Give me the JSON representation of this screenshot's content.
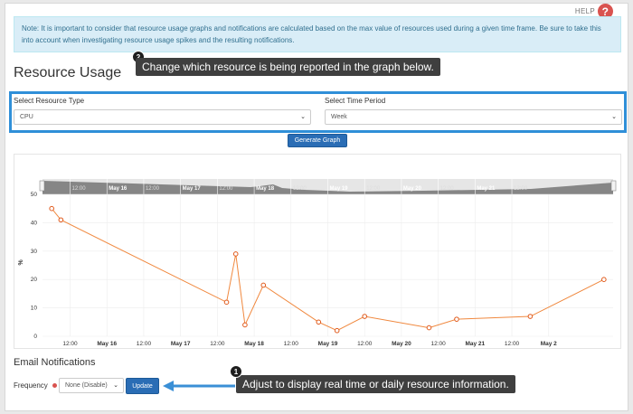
{
  "help": {
    "label": "HELP",
    "icon": "question-icon",
    "icon_glyph": "?"
  },
  "note": {
    "text": "Note: It is important to consider that resource usage graphs and notifications are calculated based on the max value of resources used during a given time frame. Be sure to take this into account when investigating resource usage spikes and the resulting notifications."
  },
  "page_title": "Resource Usage",
  "callout_2": {
    "badge": "2",
    "text": "Change which resource is being reported in the graph below."
  },
  "resource_type": {
    "label": "Select Resource Type",
    "value": "CPU"
  },
  "time_period": {
    "label": "Select Time Period",
    "value": "Week"
  },
  "generate_button": {
    "label": "Generate Graph"
  },
  "chart_data": {
    "type": "line",
    "x": [
      "2023-05-15T06:00",
      "2023-05-15T09:00",
      "2023-05-17T15:00",
      "2023-05-17T18:00",
      "2023-05-17T21:00",
      "2023-05-18T03:00",
      "2023-05-18T21:00",
      "2023-05-19T03:00",
      "2023-05-19T12:00",
      "2023-05-20T09:00",
      "2023-05-20T18:00",
      "2023-05-21T18:00",
      "2023-05-22T18:00"
    ],
    "values": [
      45,
      41,
      12,
      29,
      4,
      18,
      5,
      2,
      7,
      3,
      6,
      7,
      20
    ],
    "ylim": [
      0,
      50
    ],
    "y_ticks": [
      0,
      10,
      20,
      30,
      40,
      50
    ],
    "ylabel": "%",
    "x_tick_labels": [
      "12:00",
      "May 16",
      "12:00",
      "May 17",
      "12:00",
      "May 18",
      "12:00",
      "May 19",
      "12:00",
      "May 20",
      "12:00",
      "May 21",
      "12:00",
      "May 2"
    ],
    "navigator_labels": [
      "12:00",
      "May 16",
      "12:00",
      "May 17",
      "12:00",
      "May 18",
      "12:00",
      "May 19",
      "12:00",
      "May 20",
      "12:00",
      "May 21",
      "12:00"
    ],
    "grid": true,
    "line_color": "#f0883e"
  },
  "email_notifications": {
    "title": "Email Notifications"
  },
  "frequency": {
    "label": "Frequency",
    "value": "None (Disable)"
  },
  "update_button": {
    "label": "Update"
  },
  "callout_1": {
    "badge": "1",
    "text": "Adjust to display real time or daily resource information."
  },
  "colors": {
    "accent": "#2a6db5",
    "highlight_border": "#2f8fd8",
    "note_bg": "#d9edf7",
    "required": "#d9534f",
    "callout_bg": "#3f3f3f"
  }
}
